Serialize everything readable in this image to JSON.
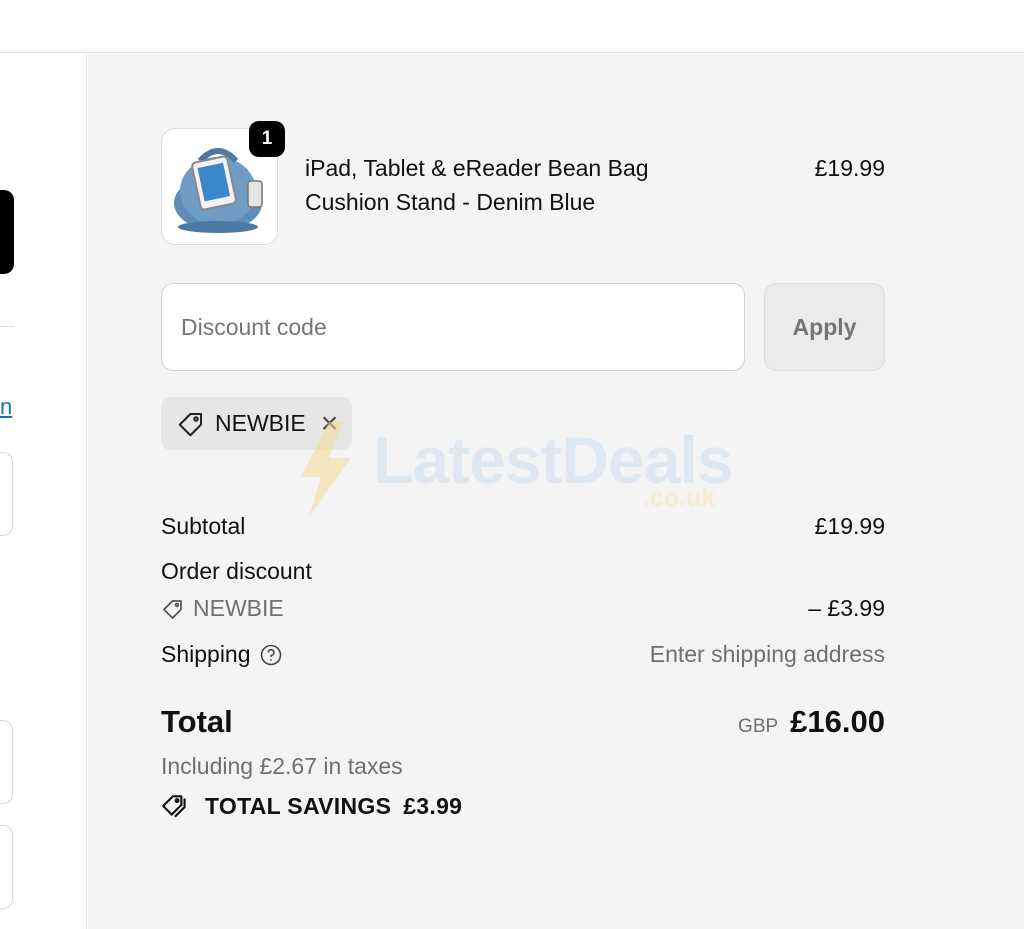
{
  "product": {
    "name": "iPad, Tablet & eReader Bean Bag Cushion Stand - Denim Blue",
    "price": "£19.99",
    "quantity": "1",
    "image_icon": "bean-bag-stand-image"
  },
  "discount": {
    "placeholder": "Discount code",
    "apply_label": "Apply",
    "applied_code": "NEWBIE"
  },
  "watermark": {
    "text": "LatestDeals",
    "subtext": ".co.uk"
  },
  "summary": {
    "subtotal_label": "Subtotal",
    "subtotal_value": "£19.99",
    "order_discount_label": "Order discount",
    "order_discount_code": "NEWBIE",
    "order_discount_value": "– £3.99",
    "shipping_label": "Shipping",
    "shipping_value": "Enter shipping address",
    "total_label": "Total",
    "total_currency": "GBP",
    "total_value": "£16.00",
    "tax_note": "Including £2.67 in taxes",
    "savings_label": "TOTAL SAVINGS",
    "savings_value": "£3.99"
  },
  "left_link_fragment": "n",
  "colors": {
    "summary_bg": "#f4f4f4",
    "link": "#1a6fa8",
    "muted_text": "#6f6f6f"
  }
}
